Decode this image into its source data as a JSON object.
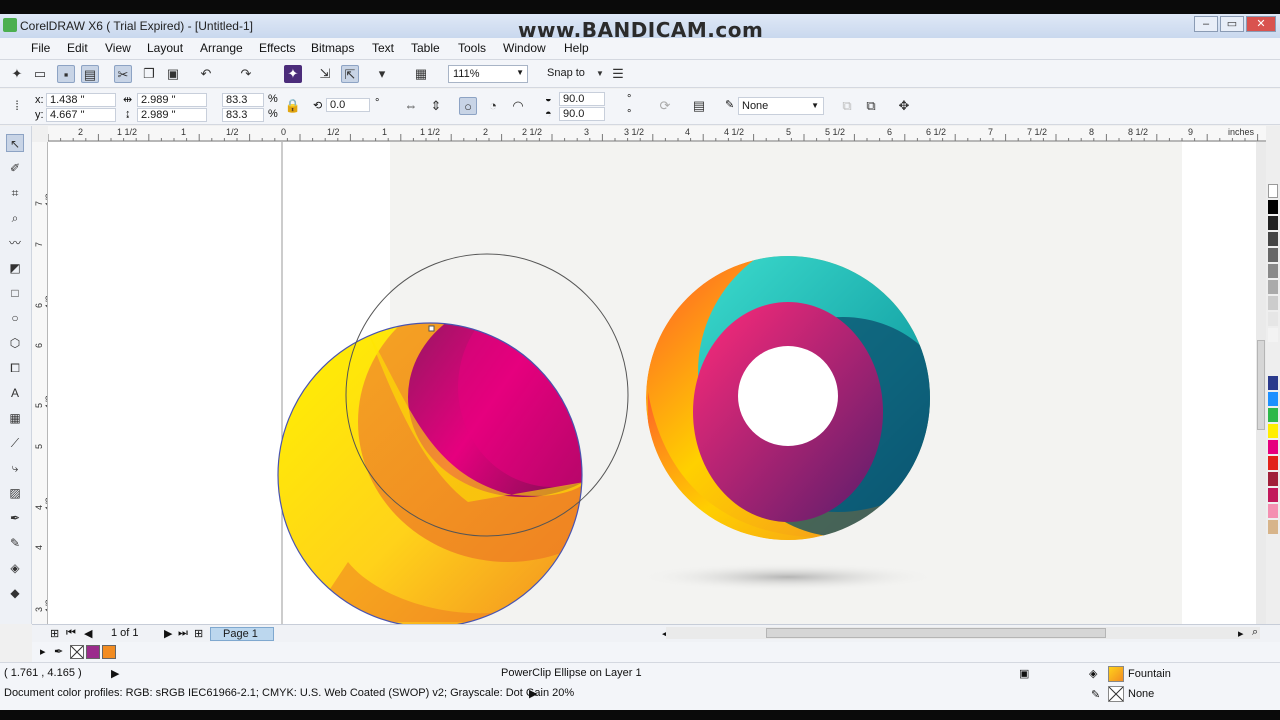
{
  "window": {
    "title": "CorelDRAW X6 ( Trial Expired) - [Untitled-1]",
    "watermark": "www.BANDICAM.com",
    "minimize": "–",
    "maximize": "▭",
    "close": "✕"
  },
  "menu": [
    "File",
    "Edit",
    "View",
    "Layout",
    "Arrange",
    "Effects",
    "Bitmaps",
    "Text",
    "Table",
    "Tools",
    "Window",
    "Help"
  ],
  "toolbar": {
    "zoom": "111%",
    "snap_to": "Snap to"
  },
  "properties": {
    "x_label": "x:",
    "x_value": "1.438 \"",
    "y_label": "y:",
    "y_value": "4.667 \"",
    "width_value": "2.989 \"",
    "height_value": "2.989 \"",
    "scale_x": "83.3",
    "scale_y": "83.3",
    "percent": "%",
    "rotation": "0.0",
    "degree": "°",
    "start_angle": "90.0",
    "end_angle": "90.0",
    "outline": "None"
  },
  "ruler": {
    "top_labels": [
      "2",
      "1 1/2",
      "1",
      "1/2",
      "0",
      "1/2",
      "1",
      "1 1/2",
      "2",
      "2 1/2",
      "3",
      "3 1/2",
      "4",
      "4 1/2",
      "5",
      "5 1/2",
      "6",
      "6 1/2",
      "7",
      "7 1/2",
      "8",
      "8 1/2",
      "9"
    ],
    "unit": "inches",
    "left_labels": [
      "7 1/2",
      "7",
      "6 1/2",
      "6",
      "5 1/2",
      "5",
      "4 1/2",
      "4",
      "3 1/2",
      "3"
    ]
  },
  "page_nav": {
    "page_count": "1 of 1",
    "page_tab": "Page 1"
  },
  "status": {
    "coords": "( 1.761 , 4.165 )",
    "object_info": "PowerClip Ellipse on Layer 1",
    "fill_label": "Fountain",
    "outline_label": "None",
    "color_profiles": "Document color profiles: RGB: sRGB IEC61966-2.1; CMYK: U.S. Web Coated (SWOP) v2; Grayscale: Dot Gain 20%"
  },
  "colors": {
    "selection_blue": "#4a54b0",
    "yellow": "#ffe600",
    "orange": "#f28c22",
    "magenta": "#e6007e",
    "teal": "#1ab5b0"
  }
}
